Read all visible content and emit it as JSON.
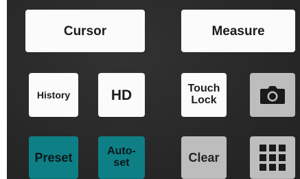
{
  "keys": {
    "cursor": "Cursor",
    "measure": "Measure",
    "history": "History",
    "hd": "HD",
    "touch_lock": [
      "Touch",
      "Lock"
    ],
    "preset": "Preset",
    "autoset": [
      "Auto-",
      "set"
    ],
    "clear": "Clear"
  },
  "icons": {
    "screenshot": "camera-icon",
    "apps": "grid-icon"
  },
  "colors": {
    "panel": "#2a2a2a",
    "white_key": "#fbfbfb",
    "grey_key": "#bdbdbd",
    "teal_key": "#0f7f86"
  }
}
